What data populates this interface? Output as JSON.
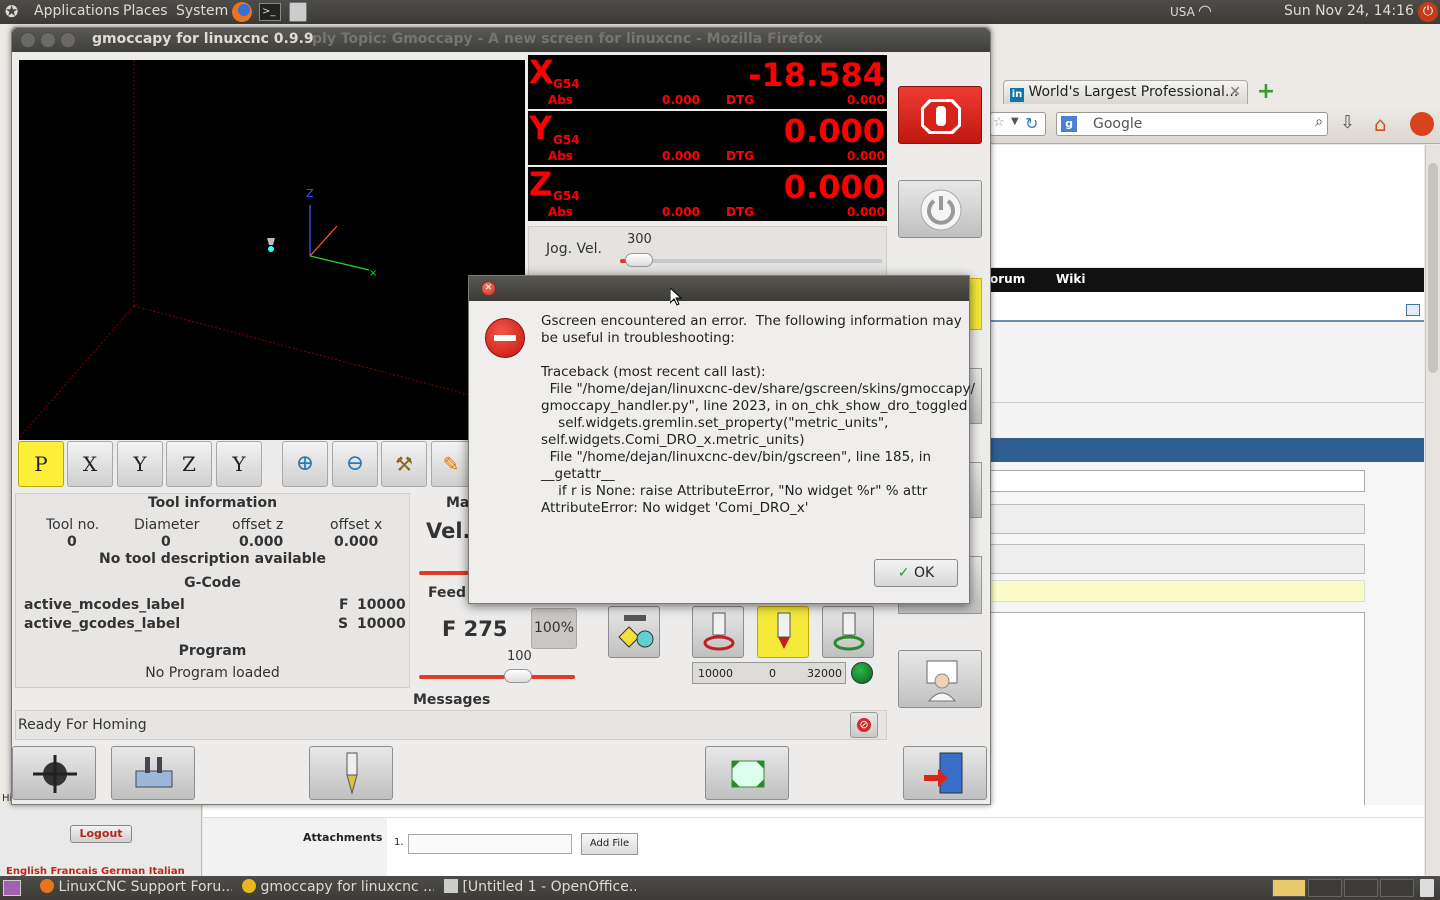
{
  "top_panel": {
    "menus": [
      "Applications",
      "Places",
      "System"
    ],
    "keyboard": "USA",
    "clock": "Sun Nov 24, 14:16"
  },
  "firefox": {
    "tab_linkedin": "World's Largest Professional...",
    "search_placeholder": "Google",
    "nav_forum": "orum",
    "nav_wiki": "Wiki",
    "attachments_label": "Attachments",
    "attachment_index": "1.",
    "add_file_label": "Add File",
    "logout_label": "Logout",
    "languages": "English Francais German Italian",
    "side_text": "Hi"
  },
  "taskbar": {
    "items": [
      "LinuxCNC Support Foru...",
      "gmoccapy for linuxcnc ...",
      "[Untitled 1 - OpenOffice..."
    ]
  },
  "gmoccapy": {
    "title": "gmoccapy for linuxcnc 0.9.9",
    "ghost_title": "ply Topic: Gmoccapy - A new screen for linuxcnc - Mozilla Firefox",
    "view_buttons": [
      "P",
      "X",
      "Y",
      "Z",
      "Y"
    ],
    "dro": [
      {
        "axis": "X",
        "coord": "G54",
        "value": "-18.584",
        "abs_label": "Abs",
        "abs": "0.000",
        "dtg_label": "DTG",
        "dtg": "0.000"
      },
      {
        "axis": "Y",
        "coord": "G54",
        "value": "0.000",
        "abs_label": "Abs",
        "abs": "0.000",
        "dtg_label": "DTG",
        "dtg": "0.000"
      },
      {
        "axis": "Z",
        "coord": "G54",
        "value": "0.000",
        "abs_label": "Abs",
        "abs": "0.000",
        "dtg_label": "DTG",
        "dtg": "0.000"
      }
    ],
    "jog": {
      "label": "Jog. Vel.",
      "value": "300"
    },
    "tool": {
      "title": "Tool information",
      "headers": [
        "Tool no.",
        "Diameter",
        "offset z",
        "offset x"
      ],
      "values": [
        "0",
        "0",
        "0.000",
        "0.000"
      ],
      "description": "No tool description available"
    },
    "gcode": {
      "title": "G-Code",
      "mcodes": "active_mcodes_label",
      "gcodes": "active_gcodes_label",
      "f_label": "F",
      "f_value": "10000",
      "s_label": "S",
      "s_value": "10000"
    },
    "program": {
      "title": "Program",
      "status": "No Program loaded"
    },
    "max_label": "Ma",
    "vel_label": "Vel.",
    "feed": {
      "label": "Feed",
      "value": "F 275",
      "override": "100%",
      "slider_value": "100"
    },
    "spindle": {
      "min": "10000",
      "current": "0",
      "max": "32000"
    },
    "messages": {
      "title": "Messages",
      "text": "Ready For Homing"
    }
  },
  "dialog": {
    "message": "Gscreen encountered an error.  The following information may\nbe useful in troubleshooting:\n\nTraceback (most recent call last):\n  File \"/home/dejan/linuxcnc-dev/share/gscreen/skins/gmoccapy/\ngmoccapy_handler.py\", line 2023, in on_chk_show_dro_toggled\n    self.widgets.gremlin.set_property(\"metric_units\",\nself.widgets.Comi_DRO_x.metric_units)\n  File \"/home/dejan/linuxcnc-dev/bin/gscreen\", line 185, in\n__getattr__\n    if r is None: raise AttributeError, \"No widget %r\" % attr\nAttributeError: No widget 'Comi_DRO_x'",
    "ok_label": "OK"
  }
}
